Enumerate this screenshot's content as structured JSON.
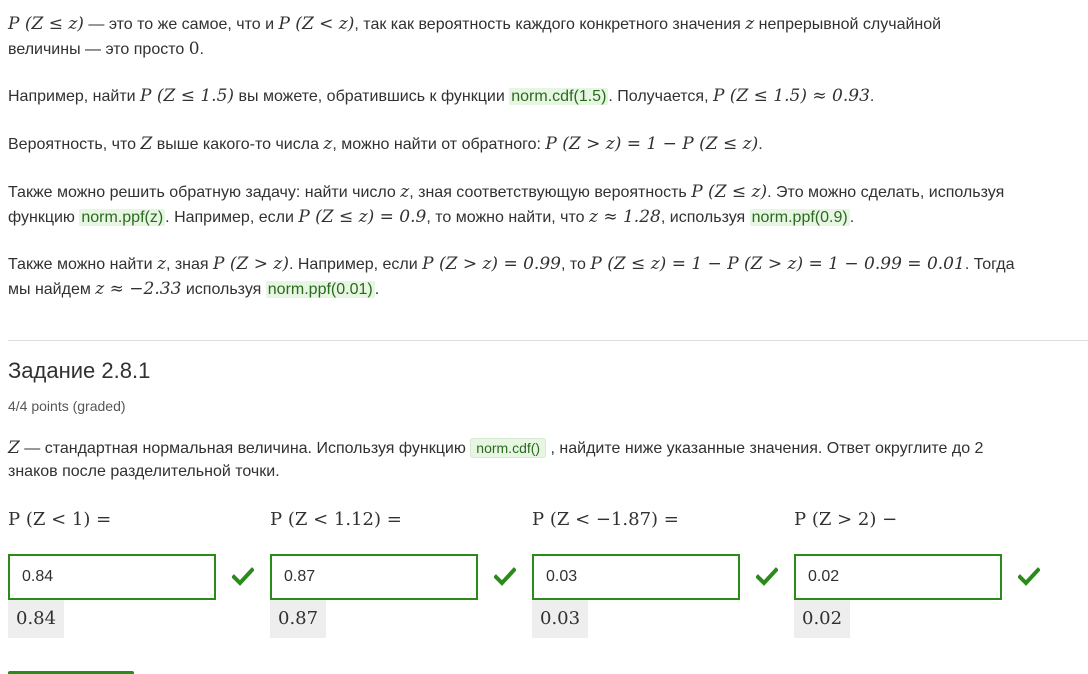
{
  "paragraphs": {
    "p1": {
      "line1_a": "P (Z ≤ z)",
      "line1_b": " — это то же самое, что и ",
      "line1_c": "P (Z < z)",
      "line1_d": ", так как вероятность каждого конкретного значения ",
      "line1_e": "z",
      "line1_f": " непрерывной случайной",
      "line2_a": "величины — это просто ",
      "line2_b": "0",
      "line2_c": "."
    },
    "p2": {
      "a": "Например, найти ",
      "b": "P (Z ≤ 1.5)",
      "c": " вы можете, обратившись к функции ",
      "code": "norm.cdf(1.5)",
      "d": ". Получается, ",
      "e": "P (Z ≤ 1.5) ≈ 0.93",
      "f": "."
    },
    "p3": {
      "a": "Вероятность, что ",
      "b": "Z",
      "c": " выше какого-то числа ",
      "d": "z",
      "e": ", можно найти от обратного: ",
      "f": "P (Z > z) = 1 − P (Z ≤ z)",
      "g": "."
    },
    "p4": {
      "line1_a": "Также можно решить обратную задачу: найти число ",
      "line1_b": "z",
      "line1_c": ", зная соответствующую вероятность ",
      "line1_d": "P (Z ≤ z)",
      "line1_e": ". Это можно сделать, используя",
      "line2_a": "функцию ",
      "line2_code1": "norm.ppf(z)",
      "line2_b": ". Например, если ",
      "line2_c": "P (Z ≤ z) = 0.9",
      "line2_d": ", то можно найти, что ",
      "line2_e": "z ≈ 1.28",
      "line2_f": ", используя ",
      "line2_code2": "norm.ppf(0.9)",
      "line2_g": "."
    },
    "p5": {
      "line1_a": "Также можно найти ",
      "line1_b": "z",
      "line1_c": ", зная ",
      "line1_d": "P (Z > z)",
      "line1_e": ". Например, если ",
      "line1_f": "P (Z > z) = 0.99",
      "line1_g": ", то ",
      "line1_h": "P (Z ≤ z) = 1 − P (Z > z) = 1 − 0.99 = 0.01",
      "line1_i": ". Тогда",
      "line2_a": "мы найдем ",
      "line2_b": "z ≈ −2.33",
      "line2_c": " используя ",
      "line2_code": "norm.ppf(0.01)",
      "line2_d": "."
    }
  },
  "problem": {
    "title": "Задание 2.8.1",
    "points": "4/4 points (graded)",
    "text_a": "Z",
    "text_b": " — стандартная нормальная величина. Используя функцию ",
    "text_code": "norm.cdf()",
    "text_c": " , найдите ниже указанные значения. Ответ округлите до 2",
    "text_line2": "знаков после разделительной точки.",
    "questions": [
      {
        "label": "P (Z < 1) =",
        "value": "0.84",
        "preview": "0.84",
        "status": "correct"
      },
      {
        "label": "P (Z < 1.12) =",
        "value": "0.87",
        "preview": "0.87",
        "status": "correct"
      },
      {
        "label": "P (Z < −1.87) =",
        "value": "0.03",
        "preview": "0.03",
        "status": "correct"
      },
      {
        "label": "P (Z > 2) −",
        "value": "0.02",
        "preview": "0.02",
        "status": "correct"
      }
    ]
  },
  "colors": {
    "accent_green": "#2a8b1a",
    "code_bg": "#e6f6e3",
    "text": "#313131"
  }
}
